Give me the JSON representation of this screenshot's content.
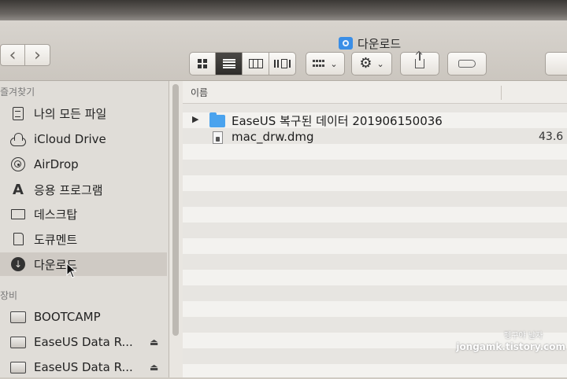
{
  "window": {
    "title": "다운로드"
  },
  "toolbar": {
    "back": "‹",
    "forward": "›",
    "view_buttons": [
      "icon-view",
      "list-view",
      "column-view",
      "coverflow-view"
    ],
    "chevron": "⌄"
  },
  "sidebar": {
    "favorites_heading": "즐겨찾기",
    "favorites": [
      {
        "label": "나의 모든 파일",
        "icon": "all-files-icon"
      },
      {
        "label": "iCloud Drive",
        "icon": "cloud-icon"
      },
      {
        "label": "AirDrop",
        "icon": "airdrop-icon"
      },
      {
        "label": "응용 프로그램",
        "icon": "applications-icon"
      },
      {
        "label": "데스크탑",
        "icon": "desktop-icon"
      },
      {
        "label": "도큐멘트",
        "icon": "documents-icon"
      },
      {
        "label": "다운로드",
        "icon": "download-icon",
        "selected": true
      }
    ],
    "devices_heading": "장비",
    "devices": [
      {
        "label": "BOOTCAMP",
        "icon": "disk-icon"
      },
      {
        "label": "EaseUS Data R...",
        "icon": "disk-icon",
        "eject": "⏏"
      },
      {
        "label": "EaseUS Data R...",
        "icon": "disk-icon",
        "eject": "⏏"
      }
    ]
  },
  "list": {
    "column_name": "이름",
    "rows": [
      {
        "name": "EaseUS 복구된 데이터 201906150036",
        "kind": "folder",
        "disclosure": "▶",
        "size": ""
      },
      {
        "name": "mac_drw.dmg",
        "kind": "dmg",
        "disclosure": "",
        "size": "43.6"
      }
    ]
  },
  "watermark": {
    "line1": "펭구야 날자",
    "line2": "jongamk.tistory.com"
  }
}
